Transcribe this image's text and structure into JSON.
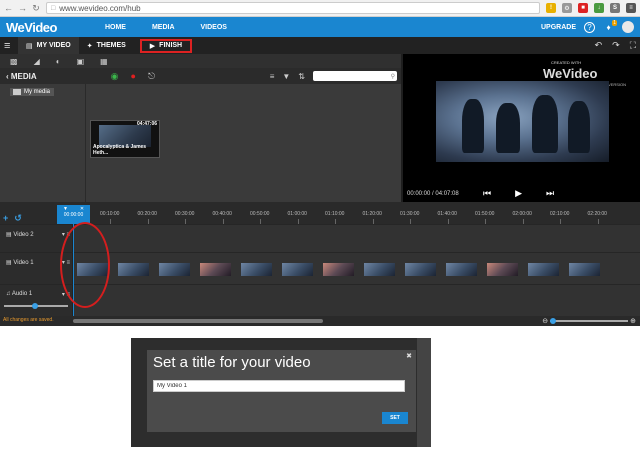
{
  "browser": {
    "url": "www.wevideo.com/hub"
  },
  "header": {
    "logo": "WeVideo",
    "nav": [
      "HOME",
      "MEDIA",
      "VIDEOS"
    ],
    "upgrade": "UPGRADE",
    "notification_count": "1",
    "accent": "#1a86d0"
  },
  "tabs": {
    "my_video": "MY VIDEO",
    "themes": "THEMES",
    "finish": "FINISH"
  },
  "media": {
    "title": "MEDIA",
    "folder": "My media",
    "clip": {
      "duration": "04:47:06",
      "title": "Apocalyptica & James Heth..."
    }
  },
  "preview": {
    "created_with": "CREATED WITH",
    "watermark": "WeVideo",
    "free_version": "FREE VERSION",
    "time": "00:00:00 / 04:07:08"
  },
  "timeline": {
    "playhead_time": "00:00:00",
    "ruler": [
      "00:10:00",
      "00:20:00",
      "00:30:00",
      "00:40:00",
      "00:50:00",
      "01:00:00",
      "01:10:00",
      "01:20:00",
      "01:30:00",
      "01:40:00",
      "01:50:00",
      "02:00:00",
      "02:10:00",
      "02:20:00"
    ],
    "tracks": [
      {
        "label": "Video 2",
        "icon": "film-icon"
      },
      {
        "label": "Video 1",
        "icon": "film-icon"
      },
      {
        "label": "Audio 1",
        "icon": "music-note-icon"
      }
    ],
    "status": "All changes are saved."
  },
  "dialog": {
    "title": "Set a title for your video",
    "value": "My Video 1",
    "button": "SET"
  }
}
